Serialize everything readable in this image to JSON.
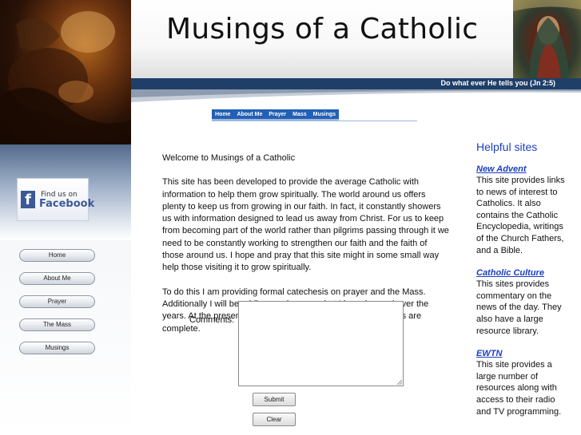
{
  "header": {
    "title": "Musings of a Catholic",
    "tagline": "Do what ever He tells you (Jn 2:5)"
  },
  "top_nav": [
    {
      "label": "Home"
    },
    {
      "label": "About Me"
    },
    {
      "label": "Prayer"
    },
    {
      "label": "Mass"
    },
    {
      "label": "Musings"
    }
  ],
  "left_sidebar": {
    "facebook_badge": {
      "line1": "Find us on",
      "line2": "Facebook"
    },
    "nav": [
      {
        "label": "Home"
      },
      {
        "label": "About Me"
      },
      {
        "label": "Prayer"
      },
      {
        "label": "The Mass"
      },
      {
        "label": "Musings"
      }
    ]
  },
  "main": {
    "paragraphs": [
      "Welcome to Musings of a Catholic",
      "This site has been developed to provide the average Catholic with information to help them grow spiritually. The world around us offers plenty to keep us from growing in our faith. In fact, it constantly showers us with information designed to lead us away from Christ. For us to keep from becoming part of the world rather than pilgrims passing through it we need to be constantly working to strengthen our faith and the faith of those around us. I hope and pray that this site might in some small way help those visiting it to grow spiritually.",
      "To do this I am providing formal catechesis on prayer and the Mass. Additionally I will be adding musings on what I have learned over the years.  At the present time the sections on prayer and the Mass are complete."
    ]
  },
  "comments_form": {
    "label": "Comments:",
    "value": "",
    "submit_label": "Submit",
    "clear_label": "Clear"
  },
  "right_sidebar": {
    "heading": "Helpful sites",
    "sites": [
      {
        "name": "New Advent",
        "description": "This site provides links to news of interest to Catholics. It also contains the Catholic Encyclopedia, writings of the Church Fathers, and a Bible."
      },
      {
        "name": "Catholic Culture",
        "description": "This sites provides commentary on the news of the day. They also have a large resource library."
      },
      {
        "name": "EWTN",
        "description": "This site provides a large number of resources along with access to their radio and TV programming."
      }
    ]
  },
  "colors": {
    "tagline_bar": "#1f3f68",
    "nav_blue": "#2360b5",
    "link_blue": "#1a3fc4",
    "facebook_blue": "#3b5998"
  }
}
